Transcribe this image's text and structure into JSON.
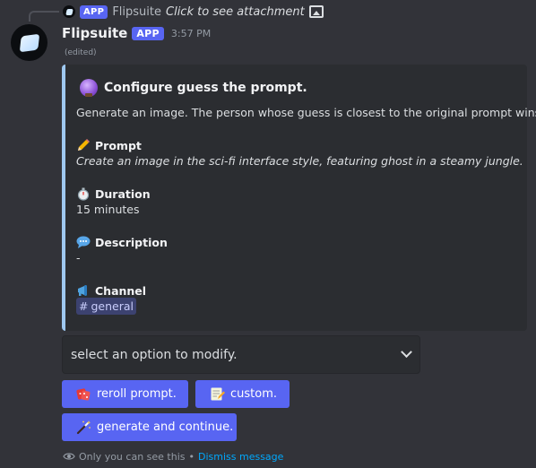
{
  "reply": {
    "app_tag": "APP",
    "name": "Flipsuite",
    "text": "Click to see attachment",
    "icon": "image-icon"
  },
  "message": {
    "username": "Flipsuite",
    "app_tag": "APP",
    "timestamp": "3:57 PM",
    "edited": "(edited)"
  },
  "embed": {
    "accent_color": "#9ec8f0",
    "title_icon": "crystal-ball-icon",
    "title": "Configure guess the prompt.",
    "description": "Generate an image. The person whose guess is closest to the original prompt wins.",
    "fields": [
      {
        "icon": "pencil-icon",
        "name": "Prompt",
        "value": "Create an image in the sci-fi interface style, featuring ghost in a steamy jungle."
      },
      {
        "icon": "stopwatch-icon",
        "name": "Duration",
        "value": "15 minutes"
      },
      {
        "icon": "speech-balloon-icon",
        "name": "Description",
        "value": "-"
      },
      {
        "icon": "megaphone-icon",
        "name": "Channel",
        "value": "general"
      }
    ]
  },
  "select": {
    "placeholder": "select an option to modify."
  },
  "buttons": {
    "reroll": {
      "icon": "dice-icon",
      "label": "reroll prompt."
    },
    "custom": {
      "icon": "memo-icon",
      "label": "custom."
    },
    "generate": {
      "icon": "magic-wand-icon",
      "label": "generate and continue."
    }
  },
  "footer": {
    "notice": "Only you can see this",
    "separator": "•",
    "dismiss": "Dismiss message"
  },
  "colors": {
    "blurple": "#5865f2",
    "background": "#323339",
    "embed_bg": "#2b2d31",
    "link": "#00a8fc"
  }
}
